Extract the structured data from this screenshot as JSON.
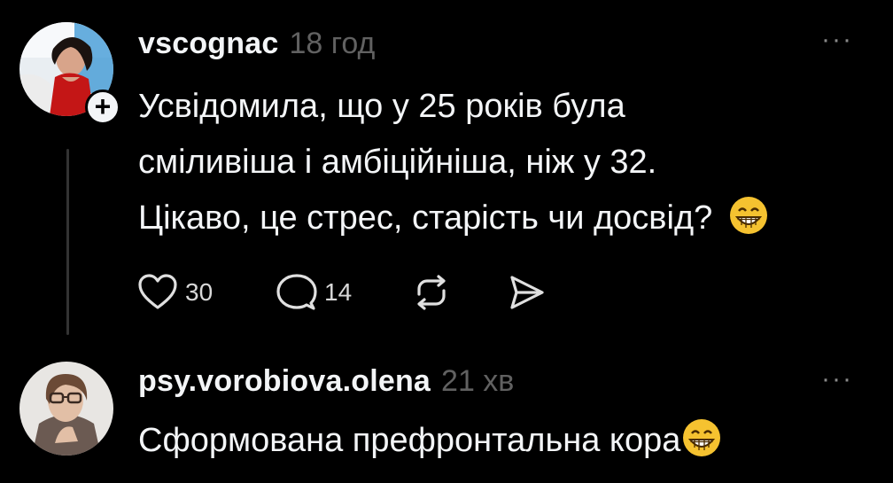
{
  "posts": [
    {
      "username": "vscognac",
      "time": "18 год",
      "lines": [
        "Усвідомила, що у 25 років була",
        "сміливіша і амбіційніша, ніж у 32.",
        "Цікаво, це стрес, старість чи досвід?"
      ],
      "actions": {
        "likes": "30",
        "comments": "14"
      }
    },
    {
      "username": "psy.vorobiova.olena",
      "time": "21 хв",
      "lines": [
        "Сформована префронтальна кора"
      ]
    }
  ],
  "more_label": "···",
  "follow_label": "+",
  "icons": [
    "heart-icon",
    "comment-icon",
    "repost-icon",
    "share-icon",
    "more-icon",
    "grin-emoji-icon"
  ],
  "colors": {
    "background": "#000000",
    "text": "#f3f5f7",
    "muted": "#616161",
    "emoji": "#f5c230"
  }
}
